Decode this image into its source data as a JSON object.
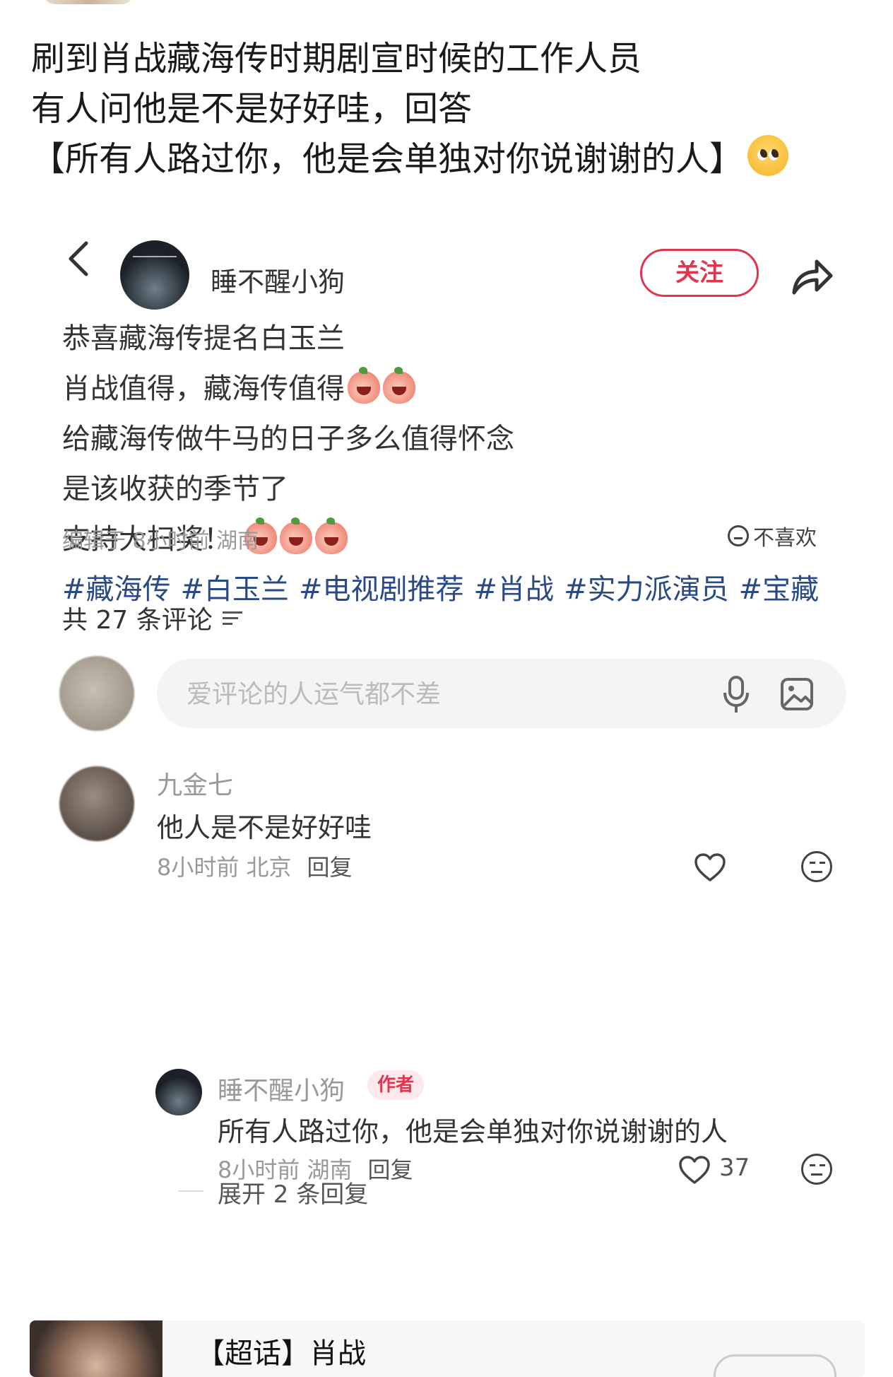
{
  "post": {
    "lines": [
      "刷到肖战藏海传时期剧宣时候的工作人员",
      "有人问他是不是好好哇，回答",
      "【所有人路过你，他是会单独对你说谢谢的人】"
    ],
    "emoji": "pleading-face-icon"
  },
  "screenshot": {
    "header": {
      "username": "睡不醒小狗",
      "follow_label": "关注"
    },
    "body": {
      "lines": [
        "恭喜藏海传提名白玉兰",
        "肖战值得，藏海传值得",
        "给藏海传做牛马的日子多么值得怀念",
        "是该收获的季节了",
        "支持大扫奖！"
      ],
      "hashtags": [
        "#藏海传",
        "#白玉兰",
        "#电视剧推荐",
        "#肖战",
        "#实力派演员",
        "#宝藏"
      ]
    },
    "meta": {
      "edited": "编辑于 8小时前 湖南",
      "dislike_label": "不喜欢"
    },
    "comments_header": {
      "count_label": "共 27 条评论"
    },
    "comment_input": {
      "placeholder": "爱评论的人运气都不差"
    },
    "comments": [
      {
        "name": "九金七",
        "text": "他人是不是好好哇",
        "time_location": "8小时前 北京",
        "reply_label": "回复"
      }
    ],
    "reply": {
      "name": "睡不醒小狗",
      "badge": "作者",
      "text": "所有人路过你，他是会单独对你说谢谢的人",
      "time_location": "8小时前 湖南",
      "reply_label": "回复",
      "likes": "37"
    },
    "expand_label": "展开 2 条回复"
  },
  "bottom_card": {
    "title": "【超话】肖战"
  },
  "colors": {
    "accent_red": "#e0364f",
    "hashtag_blue": "#2a4a86"
  }
}
